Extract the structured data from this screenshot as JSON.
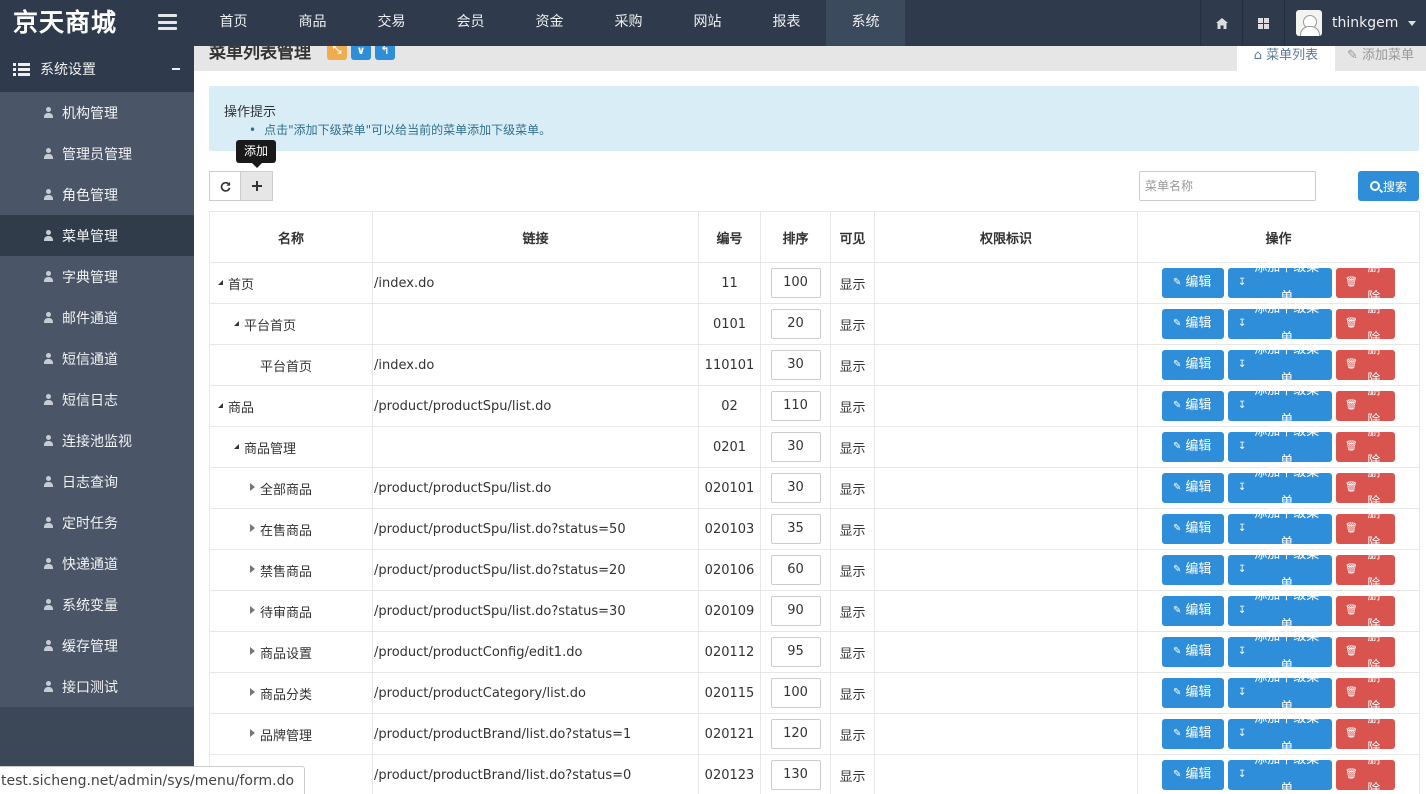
{
  "app": {
    "logo": "京天商城"
  },
  "nav": {
    "items": [
      "首页",
      "商品",
      "交易",
      "会员",
      "资金",
      "采购",
      "网站",
      "报表",
      "系统"
    ],
    "active": 8
  },
  "user": {
    "name": "thinkgem"
  },
  "sidebar": {
    "section_title": "系统设置",
    "items": [
      {
        "label": "机构管理"
      },
      {
        "label": "管理员管理"
      },
      {
        "label": "角色管理"
      },
      {
        "label": "菜单管理",
        "active": true
      },
      {
        "label": "字典管理"
      },
      {
        "label": "邮件通道"
      },
      {
        "label": "短信通道"
      },
      {
        "label": "短信日志"
      },
      {
        "label": "连接池监视"
      },
      {
        "label": "日志查询"
      },
      {
        "label": "定时任务"
      },
      {
        "label": "快递通道"
      },
      {
        "label": "系统变量"
      },
      {
        "label": "缓存管理"
      },
      {
        "label": "接口测试"
      }
    ]
  },
  "page": {
    "title": "菜单列表管理",
    "tabs": {
      "list": "菜单列表",
      "add": "添加菜单"
    },
    "alert": {
      "title": "操作提示",
      "tip": "点击\"添加下级菜单\"可以给当前的菜单添加下级菜单。"
    },
    "tooltip": "添加",
    "search": {
      "placeholder": "菜单名称",
      "button": "搜索"
    }
  },
  "table": {
    "headers": {
      "name": "名称",
      "link": "链接",
      "code": "编号",
      "sort": "排序",
      "visible": "可见",
      "perm": "权限标识",
      "ops": "操作"
    },
    "actions": {
      "edit": "编辑",
      "add_child": "添加下级菜单",
      "delete": "删除"
    },
    "rows": [
      {
        "name": "首页",
        "level": 0,
        "expander": "open",
        "link": "/index.do",
        "code": "11",
        "sort": "100",
        "visible": "显示",
        "perm": ""
      },
      {
        "name": "平台首页",
        "level": 1,
        "expander": "open",
        "link": "",
        "code": "0101",
        "sort": "20",
        "visible": "显示",
        "perm": ""
      },
      {
        "name": "平台首页",
        "level": 2,
        "expander": "none",
        "link": "/index.do",
        "code": "110101",
        "sort": "30",
        "visible": "显示",
        "perm": ""
      },
      {
        "name": "商品",
        "level": 0,
        "expander": "open",
        "link": "/product/productSpu/list.do",
        "code": "02",
        "sort": "110",
        "visible": "显示",
        "perm": ""
      },
      {
        "name": "商品管理",
        "level": 1,
        "expander": "open",
        "link": "",
        "code": "0201",
        "sort": "30",
        "visible": "显示",
        "perm": ""
      },
      {
        "name": "全部商品",
        "level": 2,
        "expander": "closed",
        "link": "/product/productSpu/list.do",
        "code": "020101",
        "sort": "30",
        "visible": "显示",
        "perm": ""
      },
      {
        "name": "在售商品",
        "level": 2,
        "expander": "closed",
        "link": "/product/productSpu/list.do?status=50",
        "code": "020103",
        "sort": "35",
        "visible": "显示",
        "perm": ""
      },
      {
        "name": "禁售商品",
        "level": 2,
        "expander": "closed",
        "link": "/product/productSpu/list.do?status=20",
        "code": "020106",
        "sort": "60",
        "visible": "显示",
        "perm": ""
      },
      {
        "name": "待审商品",
        "level": 2,
        "expander": "closed",
        "link": "/product/productSpu/list.do?status=30",
        "code": "020109",
        "sort": "90",
        "visible": "显示",
        "perm": ""
      },
      {
        "name": "商品设置",
        "level": 2,
        "expander": "closed",
        "link": "/product/productConfig/edit1.do",
        "code": "020112",
        "sort": "95",
        "visible": "显示",
        "perm": ""
      },
      {
        "name": "商品分类",
        "level": 2,
        "expander": "closed",
        "link": "/product/productCategory/list.do",
        "code": "020115",
        "sort": "100",
        "visible": "显示",
        "perm": ""
      },
      {
        "name": "品牌管理",
        "level": 2,
        "expander": "closed",
        "link": "/product/productBrand/list.do?status=1",
        "code": "020121",
        "sort": "120",
        "visible": "显示",
        "perm": ""
      },
      {
        "name": "",
        "level": 2,
        "expander": "none",
        "link": "/product/productBrand/list.do?status=0",
        "code": "020123",
        "sort": "130",
        "visible": "显示",
        "perm": ""
      }
    ]
  },
  "statusbar": {
    "url": "test.sicheng.net/admin/sys/menu/form.do"
  },
  "colors": {
    "topbar": "#2f3b4c",
    "sidebar": "#4a5568",
    "primary": "#2e8ed9",
    "danger": "#d9534f",
    "alert_bg": "#d9edf7"
  },
  "icons": {
    "home": "home-icon",
    "grid": "grid-icon",
    "refresh": "refresh-icon",
    "plus": "plus-icon",
    "search": "search-icon"
  }
}
